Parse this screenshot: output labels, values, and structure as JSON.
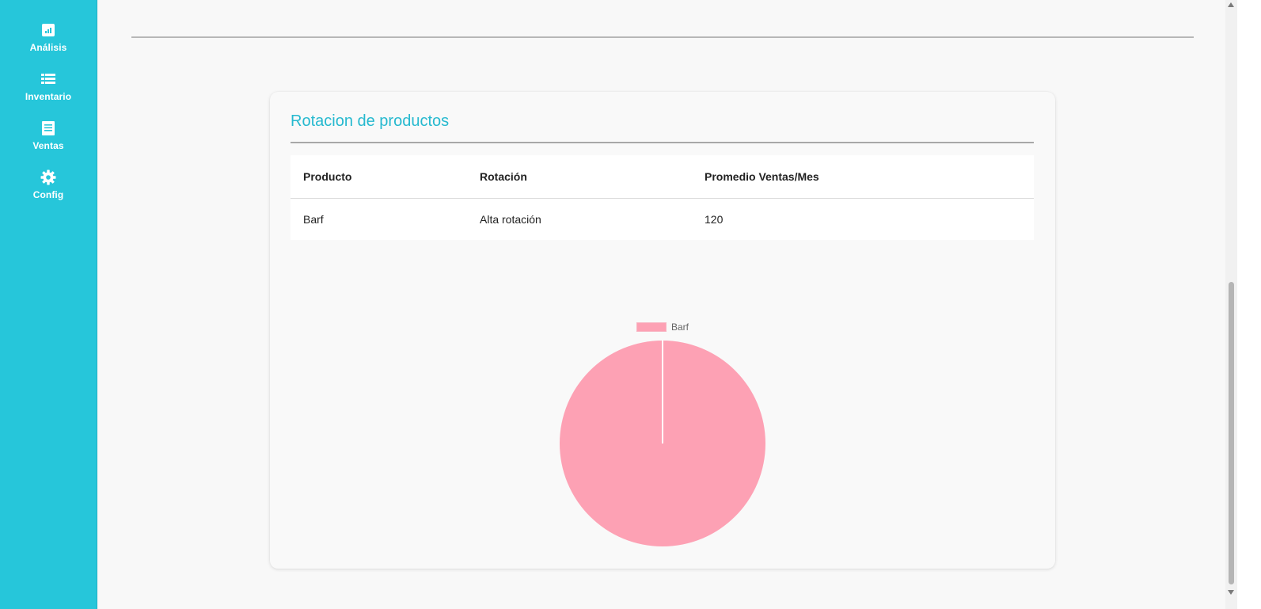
{
  "sidebar": {
    "items": [
      {
        "label": "Análisis",
        "icon": "analytics-icon"
      },
      {
        "label": "Inventario",
        "icon": "list-icon"
      },
      {
        "label": "Ventas",
        "icon": "receipt-icon"
      },
      {
        "label": "Config",
        "icon": "gear-icon"
      }
    ]
  },
  "card": {
    "title": "Rotacion de productos"
  },
  "table": {
    "headers": [
      "Producto",
      "Rotación",
      "Promedio Ventas/Mes"
    ],
    "rows": [
      [
        "Barf",
        "Alta rotación",
        "120"
      ]
    ]
  },
  "chart_data": {
    "type": "pie",
    "labels": [
      "Barf"
    ],
    "values": [
      120
    ],
    "colors": [
      "#fda1b4"
    ],
    "legend_position": "top"
  },
  "colors": {
    "accent": "#26c6da",
    "title": "#26b9cf",
    "pie": "#fda1b4"
  }
}
